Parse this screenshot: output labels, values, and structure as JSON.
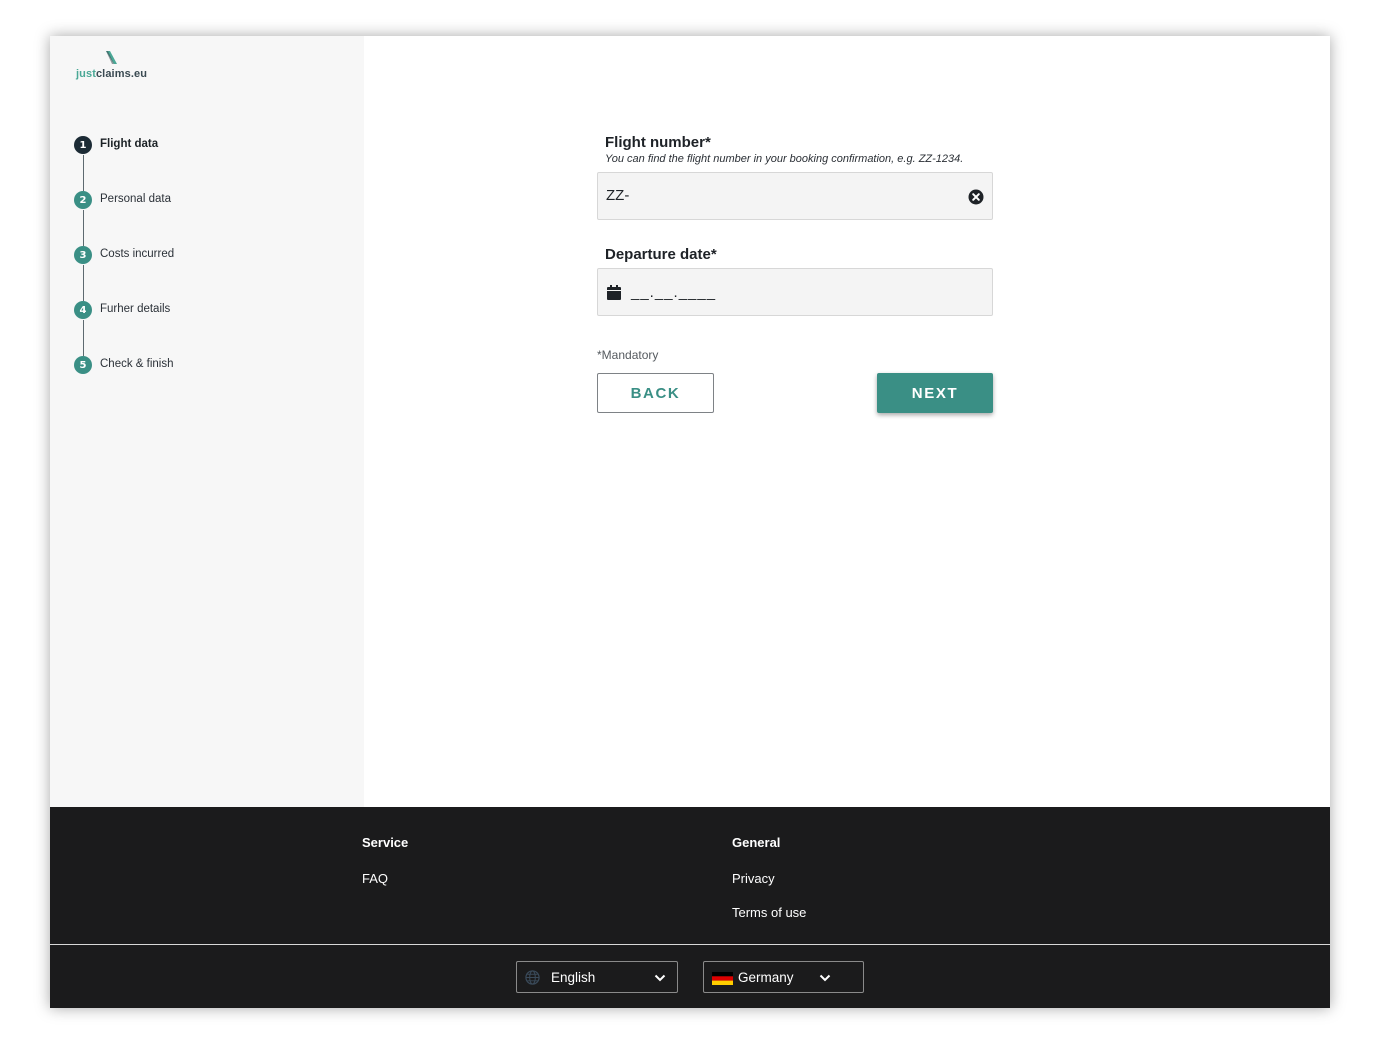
{
  "brand": {
    "logo_prefix": "just",
    "logo_suffix": "claims.eu",
    "accent": "#4aa896"
  },
  "steps": [
    {
      "number": "1",
      "label": "Flight data",
      "active": true
    },
    {
      "number": "2",
      "label": "Personal data"
    },
    {
      "number": "3",
      "label": "Costs incurred"
    },
    {
      "number": "4",
      "label": "Furher details"
    },
    {
      "number": "5",
      "label": "Check & finish"
    }
  ],
  "form": {
    "flight_number": {
      "label": "Flight number*",
      "hint": "You can find the flight number in your booking confirmation, e.g. ZZ-1234.",
      "value": "ZZ-"
    },
    "departure_date": {
      "label": "Departure date*",
      "mask": "__.__.____"
    },
    "mandatory_note": "*Mandatory",
    "back_label": "BACK",
    "next_label": "NEXT"
  },
  "footer": {
    "service": {
      "heading": "Service",
      "links": [
        "FAQ"
      ]
    },
    "general": {
      "heading": "General",
      "links": [
        "Privacy",
        "Terms of use"
      ]
    },
    "language": {
      "value": "English",
      "icon": "globe-icon"
    },
    "country": {
      "value": "Germany",
      "icon": "germany-flag-icon"
    }
  },
  "colors": {
    "primary": "#3a8f85",
    "active_step": "#1c2b35",
    "footer_bg": "#1b1b1c",
    "sidebar_bg": "#f7f7f7"
  }
}
